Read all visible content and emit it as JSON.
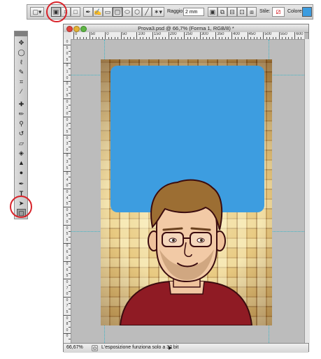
{
  "options_bar": {
    "radius_label": "Raggio:",
    "radius_value": "2 mm",
    "style_label": "Stile:",
    "color_label": "Colore:",
    "shape_color": "#3d9de0"
  },
  "tools": [
    "move",
    "lasso",
    "ellipse-marquee",
    "quick-select",
    "crop",
    "eyedropper",
    "healing-brush",
    "brush",
    "clone-stamp",
    "history-brush",
    "eraser",
    "paint-bucket",
    "blur",
    "dodge",
    "pen",
    "type",
    "path-selection",
    "rounded-rectangle"
  ],
  "document": {
    "title": "Prova3.psd @ 66,7% (Forma 1, RGB/8) *",
    "ruler_h_labels": [
      "0",
      "50",
      "0",
      "50",
      "100",
      "150",
      "200",
      "250",
      "300",
      "350",
      "400",
      "450",
      "500",
      "550",
      "600"
    ],
    "ruler_v_labels": [
      "0",
      "5",
      "0",
      "5",
      "0",
      "1",
      "0",
      "0",
      "1",
      "5",
      "0",
      "2",
      "0",
      "0",
      "2",
      "5",
      "0",
      "3",
      "0",
      "0",
      "3",
      "5",
      "0",
      "4",
      "0",
      "0",
      "4",
      "5",
      "0",
      "5",
      "0",
      "0",
      "5",
      "5",
      "0",
      "6",
      "0",
      "0",
      "6",
      "5",
      "0",
      "7",
      "0",
      "0",
      "7",
      "5",
      "0",
      "8",
      "0",
      "0"
    ],
    "shape_fill": "#3d9de0"
  },
  "status_bar": {
    "zoom": "66,67%",
    "message": "L'esposizione funziona solo a 32 bit"
  },
  "colors": {
    "highlight_ring": "#d8232a",
    "guide": "#3fb5c6"
  }
}
